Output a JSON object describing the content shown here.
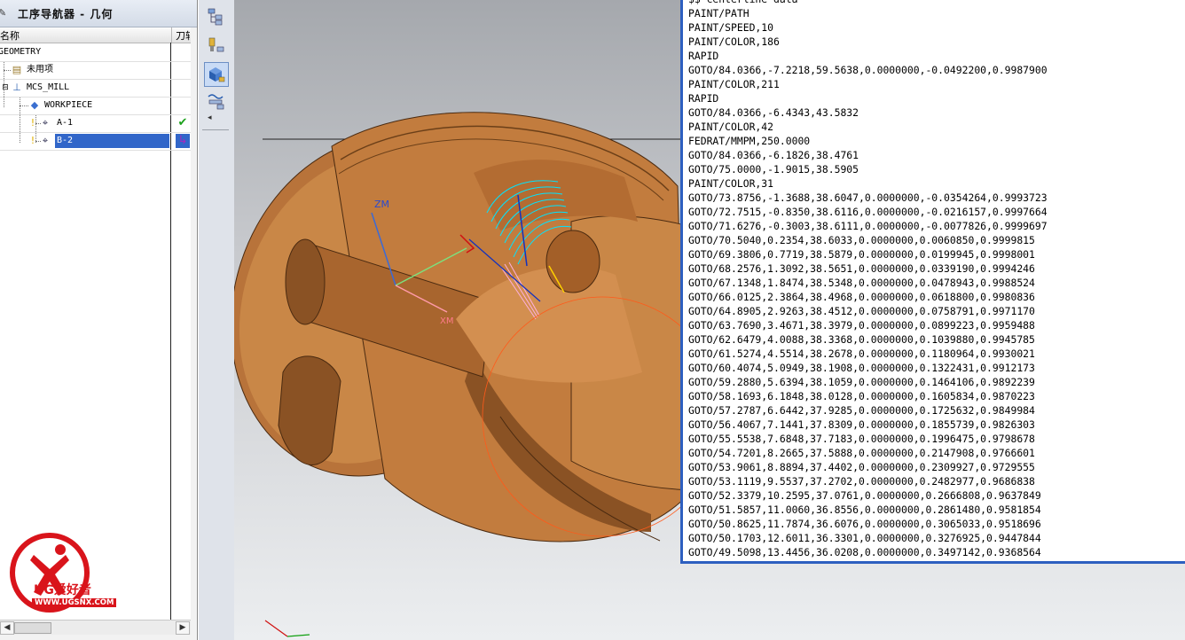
{
  "navigator": {
    "title": "工序导航器 - 几何",
    "columns": {
      "name": "名称",
      "tool": "刀轨"
    },
    "rows": [
      {
        "label": "GEOMETRY",
        "icon": "geometry-root-icon",
        "status": ""
      },
      {
        "label": "未用项",
        "icon": "unused-items-icon",
        "status": ""
      },
      {
        "label": "MCS_MILL",
        "icon": "mcs-coordinate-icon",
        "status": ""
      },
      {
        "label": "WORKPIECE",
        "icon": "workpiece-cube-icon",
        "status": ""
      },
      {
        "label": "A-1",
        "icon": "operation-icon",
        "status": "complete-checkmark"
      },
      {
        "label": "B-2",
        "icon": "operation-icon",
        "status": "regenerate-arrow",
        "selected": true
      }
    ]
  },
  "viewport": {
    "axis_label": "ZM",
    "axis_label_x": "XM"
  },
  "cls_window": {
    "lines": [
      "$$ centerline data",
      "PAINT/PATH",
      "PAINT/SPEED,10",
      "PAINT/COLOR,186",
      "RAPID",
      "GOTO/84.0366,-7.2218,59.5638,0.0000000,-0.0492200,0.9987900",
      "PAINT/COLOR,211",
      "RAPID",
      "GOTO/84.0366,-6.4343,43.5832",
      "PAINT/COLOR,42",
      "FEDRAT/MMPM,250.0000",
      "GOTO/84.0366,-6.1826,38.4761",
      "GOTO/75.0000,-1.9015,38.5905",
      "PAINT/COLOR,31",
      "GOTO/73.8756,-1.3688,38.6047,0.0000000,-0.0354264,0.9993723",
      "GOTO/72.7515,-0.8350,38.6116,0.0000000,-0.0216157,0.9997664",
      "GOTO/71.6276,-0.3003,38.6111,0.0000000,-0.0077826,0.9999697",
      "GOTO/70.5040,0.2354,38.6033,0.0000000,0.0060850,0.9999815",
      "GOTO/69.3806,0.7719,38.5879,0.0000000,0.0199945,0.9998001",
      "GOTO/68.2576,1.3092,38.5651,0.0000000,0.0339190,0.9994246",
      "GOTO/67.1348,1.8474,38.5348,0.0000000,0.0478943,0.9988524",
      "GOTO/66.0125,2.3864,38.4968,0.0000000,0.0618800,0.9980836",
      "GOTO/64.8905,2.9263,38.4512,0.0000000,0.0758791,0.9971170",
      "GOTO/63.7690,3.4671,38.3979,0.0000000,0.0899223,0.9959488",
      "GOTO/62.6479,4.0088,38.3368,0.0000000,0.1039880,0.9945785",
      "GOTO/61.5274,4.5514,38.2678,0.0000000,0.1180964,0.9930021",
      "GOTO/60.4074,5.0949,38.1908,0.0000000,0.1322431,0.9912173",
      "GOTO/59.2880,5.6394,38.1059,0.0000000,0.1464106,0.9892239",
      "GOTO/58.1693,6.1848,38.0128,0.0000000,0.1605834,0.9870223",
      "GOTO/57.2787,6.6442,37.9285,0.0000000,0.1725632,0.9849984",
      "GOTO/56.4067,7.1441,37.8309,0.0000000,0.1855739,0.9826303",
      "GOTO/55.5538,7.6848,37.7183,0.0000000,0.1996475,0.9798678",
      "GOTO/54.7201,8.2665,37.5888,0.0000000,0.2147908,0.9766601",
      "GOTO/53.9061,8.8894,37.4402,0.0000000,0.2309927,0.9729555",
      "GOTO/53.1119,9.5537,37.2702,0.0000000,0.2482977,0.9686838",
      "GOTO/52.3379,10.2595,37.0761,0.0000000,0.2666808,0.9637849",
      "GOTO/51.5857,11.0060,36.8556,0.0000000,0.2861480,0.9581854",
      "GOTO/50.8625,11.7874,36.6076,0.0000000,0.3065033,0.9518696",
      "GOTO/50.1703,12.6011,36.3301,0.0000000,0.3276925,0.9447844",
      "GOTO/49.5098,13.4456,36.0208,0.0000000,0.3497142,0.9368564"
    ]
  },
  "watermark": {
    "brand": "UG爱好者",
    "url": "WWW.UGSNX.COM"
  },
  "colors": {
    "selection": "#3166c9",
    "part": "#c07a3a",
    "toolpath": "#00e5ff",
    "window_border": "#2d5fc0"
  }
}
